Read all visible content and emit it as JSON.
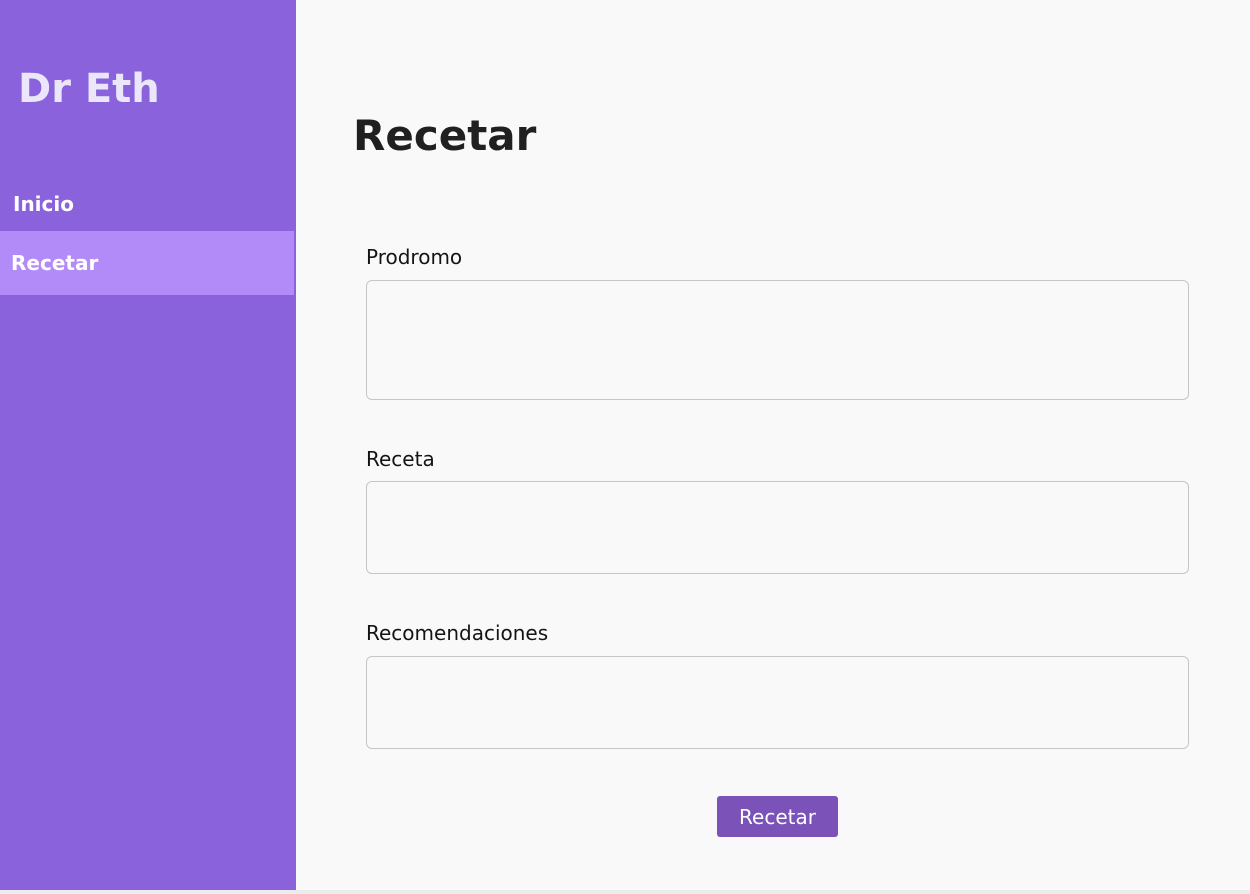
{
  "sidebar": {
    "brand": "Dr Eth",
    "items": [
      {
        "label": "Inicio",
        "active": false
      },
      {
        "label": "Recetar",
        "active": true
      }
    ]
  },
  "main": {
    "title": "Recetar",
    "fields": [
      {
        "label": "Prodromo",
        "value": ""
      },
      {
        "label": "Receta",
        "value": ""
      },
      {
        "label": "Recomendaciones",
        "value": ""
      }
    ],
    "submit_label": "Recetar"
  },
  "colors": {
    "sidebar_bg": "#8962dc",
    "active_item_bg": "#b28bf8",
    "button_bg": "#7b52b8",
    "page_bg": "#f9f9f9"
  }
}
